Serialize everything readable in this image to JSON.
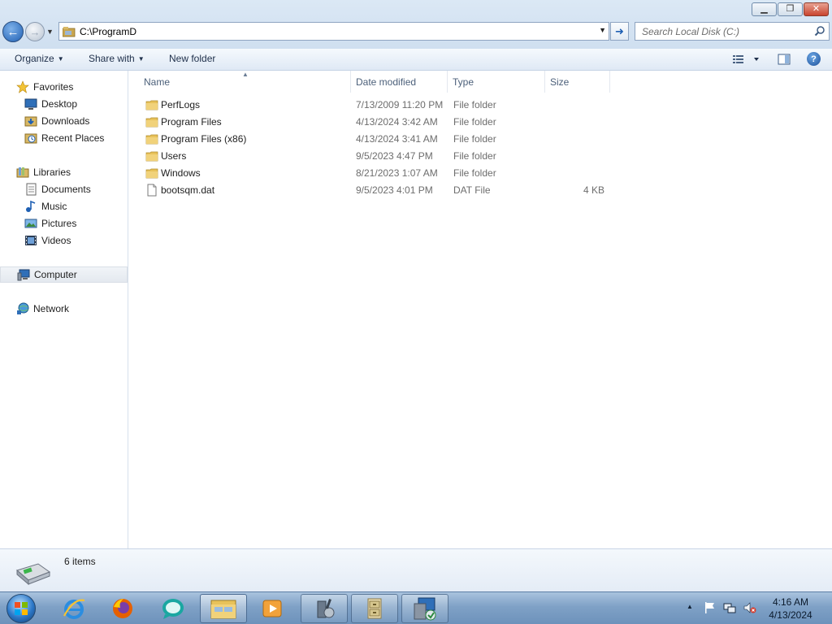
{
  "window": {
    "minimize_glyph": "▁",
    "maximize_glyph": "❐",
    "close_glyph": "✕"
  },
  "nav": {
    "back_glyph": "←",
    "forward_glyph": "→"
  },
  "address": {
    "value": "C:\\ProgramD"
  },
  "search": {
    "placeholder": "Search Local Disk (C:)"
  },
  "toolbar": {
    "organize": "Organize",
    "share_with": "Share with",
    "new_folder": "New folder",
    "help_glyph": "?"
  },
  "sidebar": {
    "favorites": "Favorites",
    "desktop": "Desktop",
    "downloads": "Downloads",
    "recent_places": "Recent Places",
    "libraries": "Libraries",
    "documents": "Documents",
    "music": "Music",
    "pictures": "Pictures",
    "videos": "Videos",
    "computer": "Computer",
    "network": "Network"
  },
  "columns": {
    "name": "Name",
    "date_modified": "Date modified",
    "type": "Type",
    "size": "Size"
  },
  "files": [
    {
      "name": "PerfLogs",
      "date": "7/13/2009 11:20 PM",
      "type": "File folder",
      "size": "",
      "icon": "folder-icon"
    },
    {
      "name": "Program Files",
      "date": "4/13/2024 3:42 AM",
      "type": "File folder",
      "size": "",
      "icon": "folder-icon"
    },
    {
      "name": "Program Files (x86)",
      "date": "4/13/2024 3:41 AM",
      "type": "File folder",
      "size": "",
      "icon": "folder-icon"
    },
    {
      "name": "Users",
      "date": "9/5/2023 4:47 PM",
      "type": "File folder",
      "size": "",
      "icon": "folder-icon"
    },
    {
      "name": "Windows",
      "date": "8/21/2023 1:07 AM",
      "type": "File folder",
      "size": "",
      "icon": "folder-icon"
    },
    {
      "name": "bootsqm.dat",
      "date": "9/5/2023 4:01 PM",
      "type": "DAT File",
      "size": "4 KB",
      "icon": "file-icon"
    }
  ],
  "details": {
    "item_count": "6 items"
  },
  "taskbar": {
    "clock_time": "4:16 AM",
    "clock_date": "4/13/2024"
  },
  "colors": {
    "accent": "#1e5fb3",
    "folder": "#e8c25a",
    "taskbar": "#7fa1c6"
  }
}
